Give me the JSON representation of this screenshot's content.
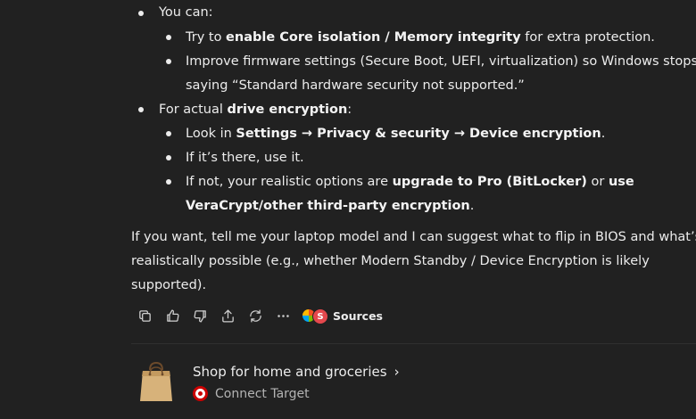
{
  "content": {
    "top_bullet": "You can:",
    "sub1": {
      "pre": "Try to ",
      "bold": "enable Core isolation / Memory integrity",
      "post": " for extra protection."
    },
    "sub2": {
      "line1": "Improve firmware settings (Secure Boot, UEFI, virtualization) so Windows stops",
      "line2": "saying “Standard hardware security not supported.”"
    },
    "bullet2": {
      "pre": "For actual ",
      "bold": "drive encryption",
      "post": ":"
    },
    "sub3": {
      "pre": "Look in ",
      "b1": "Settings",
      "arrow1": " → ",
      "b2": "Privacy & security",
      "arrow2": " → ",
      "b3": "Device encryption",
      "post": "."
    },
    "sub4": "If it’s there, use it.",
    "sub5": {
      "pre": "If not, your realistic options are ",
      "b1": "upgrade to Pro (BitLocker)",
      "mid": " or ",
      "b2": "use",
      "b3": "VeraCrypt/other third-party encryption",
      "post": "."
    },
    "para": {
      "line1": "If you want, tell me your laptop model and I can suggest what to flip in BIOS and what’s",
      "line2": "realistically possible (e.g., whether Modern Standby / Device Encryption is likely",
      "line3": "supported)."
    }
  },
  "actions": {
    "icons": [
      "copy-icon",
      "thumbs-up-icon",
      "thumbs-down-icon",
      "share-icon",
      "regenerate-icon",
      "more-icon"
    ],
    "sources_label": "Sources",
    "sources_badge": "S"
  },
  "card": {
    "title": "Shop for home and groceries",
    "chevron": "›",
    "subtitle": "Connect Target"
  }
}
